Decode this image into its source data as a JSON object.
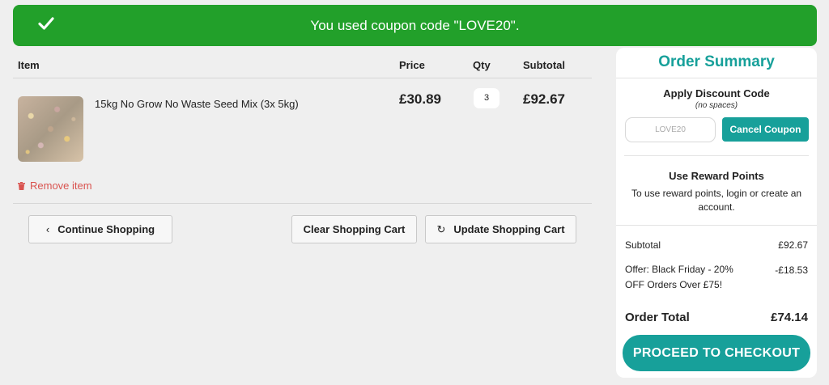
{
  "banner": {
    "message": "You used coupon code \"LOVE20\".",
    "color": "#22a02a",
    "icon": "check-icon"
  },
  "cart": {
    "headers": {
      "item": "Item",
      "price": "Price",
      "qty": "Qty",
      "subtotal": "Subtotal"
    },
    "items": [
      {
        "name": "15kg No Grow No Waste Seed Mix (3x 5kg)",
        "price": "£30.89",
        "qty": "3",
        "subtotal": "£92.67",
        "remove_label": "Remove item"
      }
    ],
    "buttons": {
      "continue": "Continue Shopping",
      "clear": "Clear Shopping Cart",
      "update": "Update Shopping Cart"
    }
  },
  "summary": {
    "title": "Order Summary",
    "discount_title": "Apply Discount Code",
    "discount_note": "(no spaces)",
    "coupon_value": "LOVE20",
    "cancel_label": "Cancel Coupon",
    "reward_title": "Use Reward Points",
    "reward_text": "To use reward points, login or create an account.",
    "subtotal_label": "Subtotal",
    "subtotal_value": "£92.67",
    "offer_label": "Offer: Black Friday - 20% OFF Orders Over £75!",
    "offer_value": "-£18.53",
    "total_label": "Order Total",
    "total_value": "£74.14",
    "checkout_label": "PROCEED TO CHECKOUT",
    "accent_color": "#17a09a"
  }
}
